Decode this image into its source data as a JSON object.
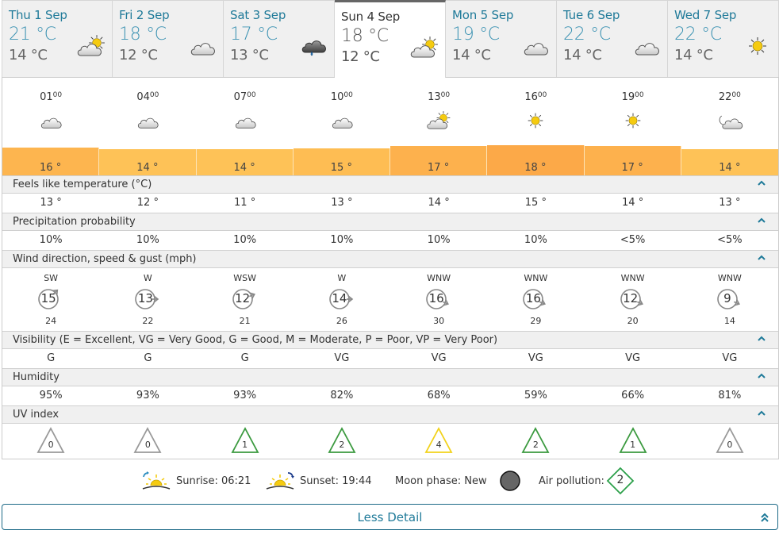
{
  "days": [
    {
      "date": "Thu 1 Sep",
      "high": "21 °C",
      "low": "14 °C",
      "icon": "sun-cloud-icon",
      "active": false
    },
    {
      "date": "Fri 2 Sep",
      "high": "18 °C",
      "low": "12 °C",
      "icon": "cloud-icon",
      "active": false
    },
    {
      "date": "Sat 3 Sep",
      "high": "17 °C",
      "low": "13 °C",
      "icon": "light-rain-cloud-icon",
      "active": false
    },
    {
      "date": "Sun 4 Sep",
      "high": "18 °C",
      "low": "12 °C",
      "icon": "sun-cloud-icon",
      "active": true
    },
    {
      "date": "Mon 5 Sep",
      "high": "19 °C",
      "low": "14 °C",
      "icon": "cloud-icon",
      "active": false
    },
    {
      "date": "Tue 6 Sep",
      "high": "22 °C",
      "low": "14 °C",
      "icon": "cloud-icon",
      "active": false
    },
    {
      "date": "Wed 7 Sep",
      "high": "22 °C",
      "low": "14 °C",
      "icon": "sun-icon",
      "active": false
    }
  ],
  "hours": [
    {
      "hour": "01",
      "min": "00",
      "icon": "cloud-icon"
    },
    {
      "hour": "04",
      "min": "00",
      "icon": "cloud-icon"
    },
    {
      "hour": "07",
      "min": "00",
      "icon": "cloud-icon"
    },
    {
      "hour": "10",
      "min": "00",
      "icon": "cloud-icon"
    },
    {
      "hour": "13",
      "min": "00",
      "icon": "sun-cloud-icon"
    },
    {
      "hour": "16",
      "min": "00",
      "icon": "sun-icon"
    },
    {
      "hour": "19",
      "min": "00",
      "icon": "sun-icon"
    },
    {
      "hour": "22",
      "min": "00",
      "icon": "moon-cloud-icon"
    }
  ],
  "temperature": {
    "values": [
      16,
      14,
      14,
      15,
      17,
      18,
      17,
      14
    ],
    "labels": [
      "16 °",
      "14 °",
      "14 °",
      "15 °",
      "17 °",
      "18 °",
      "17 °",
      "14 °"
    ],
    "colors": [
      "#fdb54f",
      "#fec257",
      "#fec257",
      "#febd53",
      "#fdb14d",
      "#fca948",
      "#fdb14d",
      "#fec257"
    ]
  },
  "sections": {
    "feels_like": {
      "title": "Feels like temperature (°C)",
      "values": [
        "13 °",
        "12 °",
        "11 °",
        "13 °",
        "14 °",
        "15 °",
        "14 °",
        "13 °"
      ]
    },
    "precipitation": {
      "title": "Precipitation probability",
      "values": [
        "10%",
        "10%",
        "10%",
        "10%",
        "10%",
        "10%",
        "<5%",
        "<5%"
      ]
    },
    "wind": {
      "title": "Wind direction, speed & gust (mph)",
      "directions": [
        "SW",
        "W",
        "WSW",
        "W",
        "WNW",
        "WNW",
        "WNW",
        "WNW"
      ],
      "speeds": [
        "15",
        "13",
        "12",
        "14",
        "16",
        "16",
        "12",
        "9"
      ],
      "gusts": [
        "24",
        "22",
        "21",
        "26",
        "30",
        "29",
        "20",
        "14"
      ]
    },
    "visibility": {
      "title": "Visibility (E = Excellent, VG = Very Good, G = Good, M = Moderate, P = Poor, VP = Very Poor)",
      "values": [
        "G",
        "G",
        "G",
        "VG",
        "VG",
        "VG",
        "VG",
        "VG"
      ]
    },
    "humidity": {
      "title": "Humidity",
      "values": [
        "95%",
        "93%",
        "93%",
        "82%",
        "68%",
        "59%",
        "66%",
        "81%"
      ]
    },
    "uv": {
      "title": "UV index",
      "values": [
        "0",
        "0",
        "1",
        "2",
        "4",
        "2",
        "1",
        "0"
      ],
      "colors": [
        "#999999",
        "#999999",
        "#3b9a3f",
        "#3b9a3f",
        "#f2d21b",
        "#3b9a3f",
        "#3b9a3f",
        "#999999"
      ]
    }
  },
  "footer": {
    "sunrise": "Sunrise: 06:21",
    "sunset": "Sunset: 19:44",
    "moon": "Moon phase: New",
    "air_pollution_label": "Air pollution:",
    "air_pollution_value": "2"
  },
  "less_detail": "Less Detail",
  "colors": {
    "accent": "#1f7a99",
    "chevron": "#1f7a99",
    "uv_low": "#3b9a3f",
    "uv_moderate": "#f2d21b",
    "uv_none": "#999999",
    "air_pollution": "#2ca04a"
  }
}
